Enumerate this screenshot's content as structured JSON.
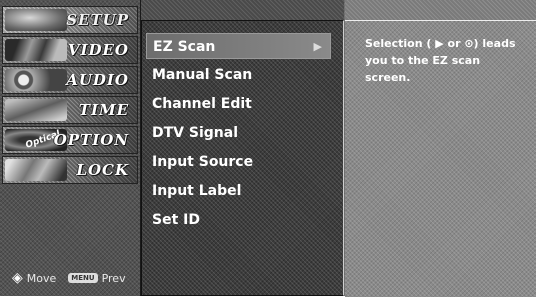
{
  "left_menu": {
    "tabs": [
      {
        "label": "SETUP",
        "icon": "setup-image"
      },
      {
        "label": "VIDEO",
        "icon": "video-image"
      },
      {
        "label": "AUDIO",
        "icon": "audio-image"
      },
      {
        "label": "TIME",
        "icon": "time-image"
      },
      {
        "label": "OPTION",
        "icon": "option-image",
        "badge": "Optical"
      },
      {
        "label": "LOCK",
        "icon": "lock-image"
      }
    ],
    "active_tab": "SETUP",
    "hint": {
      "move_icon": "◈",
      "move_label": "Move",
      "menu_key": "MENU",
      "prev_label": "Prev"
    }
  },
  "submenu": {
    "items": [
      {
        "label": "EZ Scan",
        "arrow": "▶"
      },
      {
        "label": "Manual Scan"
      },
      {
        "label": "Channel Edit"
      },
      {
        "label": "DTV Signal"
      },
      {
        "label": "Input Source"
      },
      {
        "label": "Input Label"
      },
      {
        "label": "Set ID"
      }
    ],
    "selected": "EZ Scan"
  },
  "help": {
    "text": "Selection ( ▶ or ⊙) leads you to the EZ scan screen."
  },
  "colors": {
    "background": "#6f6f6f",
    "text": "#ffffff"
  }
}
